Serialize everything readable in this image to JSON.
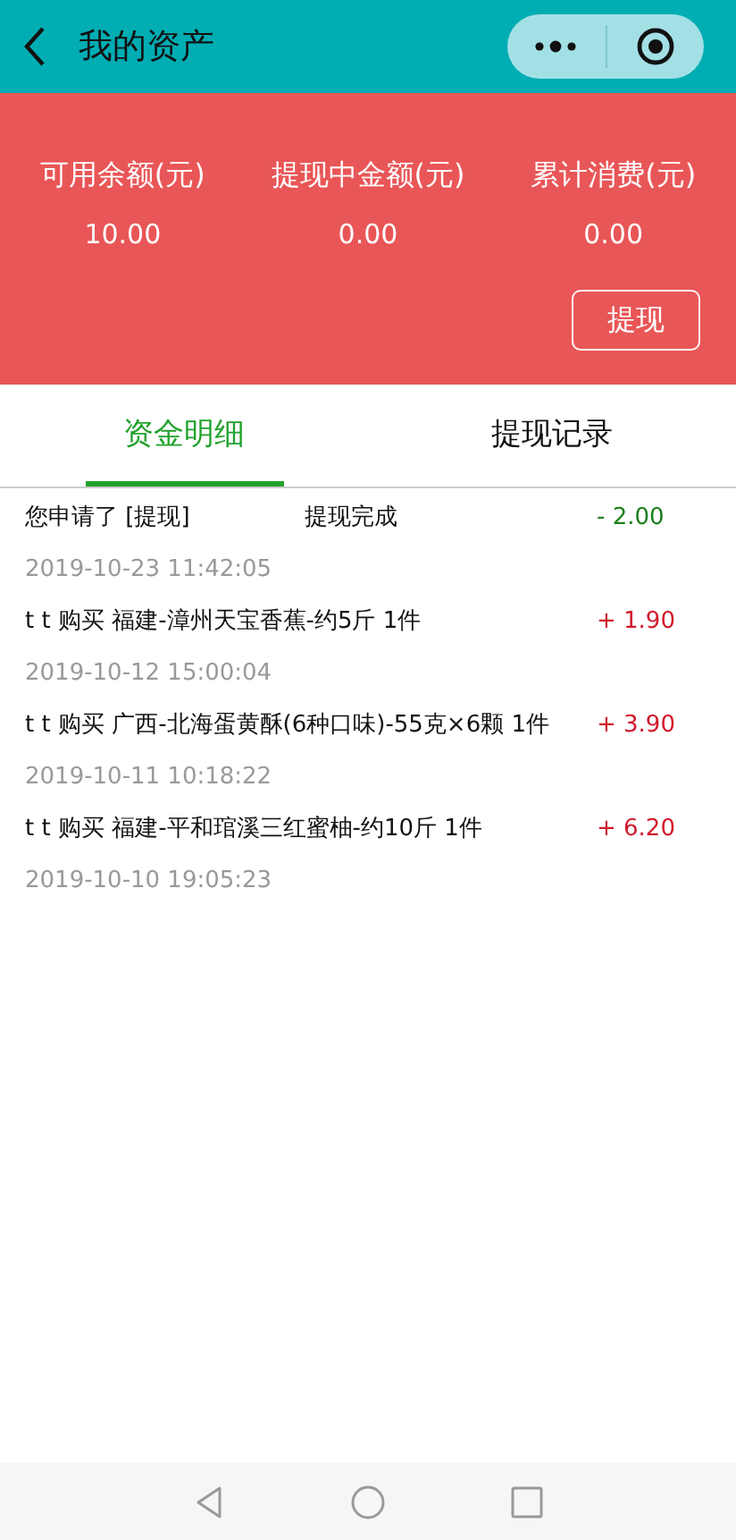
{
  "header": {
    "title": "我的资产"
  },
  "summary": [
    {
      "label": "可用余额(元)",
      "value": "10.00"
    },
    {
      "label": "提现中金额(元)",
      "value": "0.00"
    },
    {
      "label": "累计消费(元)",
      "value": "0.00"
    }
  ],
  "withdraw_button": "提现",
  "tabs": [
    {
      "label": "资金明细",
      "selected": true
    },
    {
      "label": "提现记录",
      "selected": false
    }
  ],
  "records": [
    {
      "text": "您申请了 [提现]",
      "status": "提现完成",
      "amount": "- 2.00",
      "kind": "expense",
      "time": "2019-10-23 11:42:05"
    },
    {
      "text": "t t 购买 福建-漳州天宝香蕉-约5斤 1件",
      "amount": "+ 1.90",
      "kind": "income",
      "time": "2019-10-12 15:00:04"
    },
    {
      "text": "t t 购买 广西-北海蛋黄酥(6种口味)-55克×6颗 1件",
      "amount": "+ 3.90",
      "kind": "income",
      "time": "2019-10-11 10:18:22"
    },
    {
      "text": "t t 购买 福建-平和琯溪三红蜜柚-约10斤 1件",
      "amount": "+ 6.20",
      "kind": "income",
      "time": "2019-10-10 19:05:23"
    }
  ]
}
